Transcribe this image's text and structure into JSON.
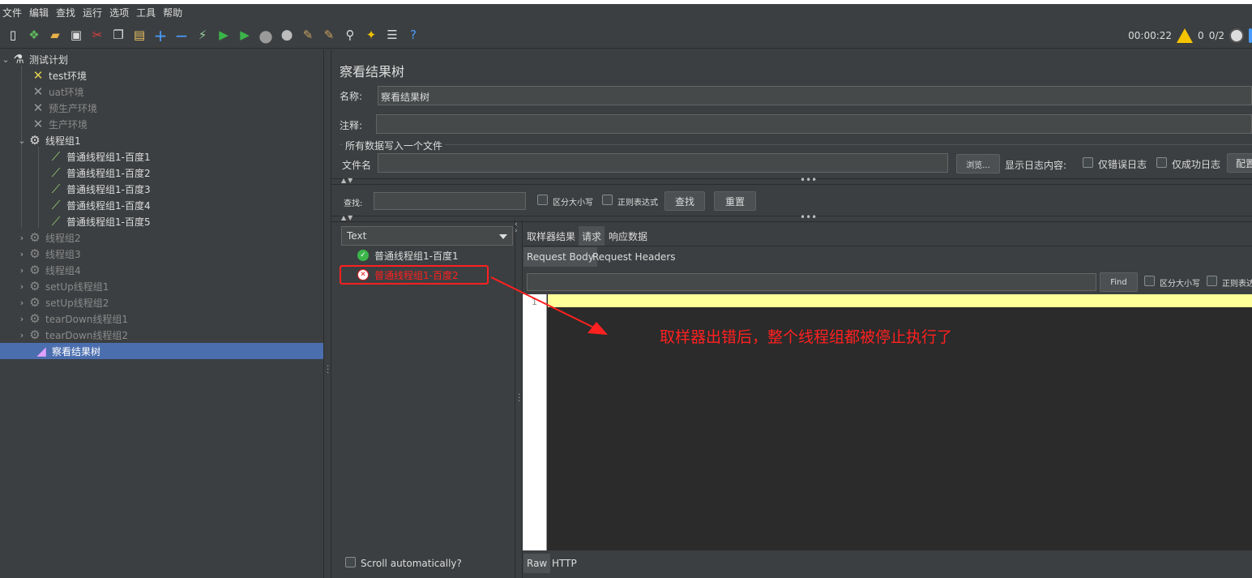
{
  "menu": [
    "文件",
    "编辑",
    "查找",
    "运行",
    "选项",
    "工具",
    "帮助"
  ],
  "toolbar": {
    "timer": "00:00:22",
    "warn_count": "0",
    "threads": "0/2"
  },
  "tree": {
    "root": "测试计划",
    "env_items": [
      "test环境",
      "uat环境",
      "预生产环境",
      "生产环境"
    ],
    "group1": "线程组1",
    "group1_children": [
      "普通线程组1-百度1",
      "普通线程组1-百度2",
      "普通线程组1-百度3",
      "普通线程组1-百度4",
      "普通线程组1-百度5"
    ],
    "other_groups": [
      "线程组2",
      "线程组3",
      "线程组4",
      "setUp线程组1",
      "setUp线程组2",
      "tearDown线程组1",
      "tearDown线程组2"
    ],
    "selected": "察看结果树"
  },
  "panel": {
    "title": "察看结果树",
    "name_label": "名称:",
    "name_value": "察看结果树",
    "comment_label": "注释:",
    "file_section": "所有数据写入一个文件",
    "file_label": "文件名",
    "browse": "浏览...",
    "log_label": "显示日志内容:",
    "errors_only": "仅错误日志",
    "success_only": "仅成功日志",
    "config": "配置",
    "search_label": "查找:",
    "case_sensitive": "区分大小写",
    "regex": "正则表达式",
    "find_btn": "查找",
    "reset_btn": "重置"
  },
  "results": {
    "renderer": "Text",
    "items": [
      {
        "label": "普通线程组1-百度1",
        "status": "ok"
      },
      {
        "label": "普通线程组1-百度2",
        "status": "error"
      }
    ],
    "scroll_auto": "Scroll automatically?"
  },
  "detail": {
    "tabs": [
      "取样器结果",
      "请求",
      "响应数据"
    ],
    "active_tab": "请求",
    "subtabs": [
      "Request Body",
      "Request Headers"
    ],
    "find_btn": "Find",
    "case_sensitive": "区分大小写",
    "regex": "正则表达式",
    "line_number": "1",
    "bottom_tabs": [
      "Raw",
      "HTTP"
    ]
  },
  "annotation": "取样器出错后，整个线程组都被停止执行了",
  "colors": {
    "accent_selected": "#4b6eaf",
    "error_red": "#ff2020",
    "ok_green": "#3bb54a",
    "highlight_line": "#ffff99"
  }
}
